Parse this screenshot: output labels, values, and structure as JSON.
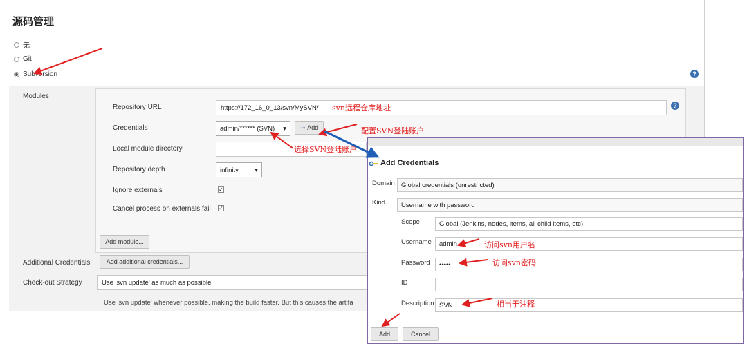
{
  "section": {
    "title": "源码管理"
  },
  "scm_options": [
    {
      "label": "无",
      "selected": false
    },
    {
      "label": "Git",
      "selected": false
    },
    {
      "label": "Subversion",
      "selected": true
    }
  ],
  "help_icon_text": "?",
  "modules": {
    "label": "Modules",
    "repository_url": {
      "label": "Repository URL",
      "value": "https://172_16_0_13/svn/MySVN/"
    },
    "credentials": {
      "label": "Credentials",
      "value": "admin/****** (SVN)",
      "add_label": "Add"
    },
    "local_module_directory": {
      "label": "Local module directory",
      "value": "."
    },
    "repository_depth": {
      "label": "Repository depth",
      "value": "infinity"
    },
    "ignore_externals": {
      "label": "Ignore externals",
      "checked": true
    },
    "cancel_process": {
      "label": "Cancel process on externals fail",
      "checked": true
    },
    "add_module_label": "Add module..."
  },
  "additional_credentials": {
    "label": "Additional Credentials",
    "button_label": "Add additional credentials..."
  },
  "checkout_strategy": {
    "label": "Check-out Strategy",
    "value": "Use 'svn update' as much as possible",
    "description": "Use 'svn update' whenever possible, making the build faster. But this causes the artifa"
  },
  "dialog": {
    "title": "Add Credentials",
    "domain": {
      "label": "Domain",
      "value": "Global credentials (unrestricted)"
    },
    "kind": {
      "label": "Kind",
      "value": "Username with password"
    },
    "scope": {
      "label": "Scope",
      "value": "Global (Jenkins, nodes, items, all child items, etc)"
    },
    "username": {
      "label": "Username",
      "value": "admin"
    },
    "password": {
      "label": "Password",
      "value": "•••••"
    },
    "id": {
      "label": "ID",
      "value": ""
    },
    "description": {
      "label": "Description",
      "value": "SVN"
    },
    "add_label": "Add",
    "cancel_label": "Cancel"
  },
  "annotations": {
    "svn_url": "svn远程仓库地址",
    "configure_account": "配置SVN登陆账户",
    "select_account": "选择SVN登陆账户",
    "svn_username": "访问svn用户名",
    "svn_password": "访问svn密码",
    "comment": "相当于注释"
  },
  "colors": {
    "annotation_red": "#e02020",
    "arrow_blue": "#1f5fb8",
    "dialog_border": "#7c68a6",
    "help_blue": "#3a6fb0"
  }
}
